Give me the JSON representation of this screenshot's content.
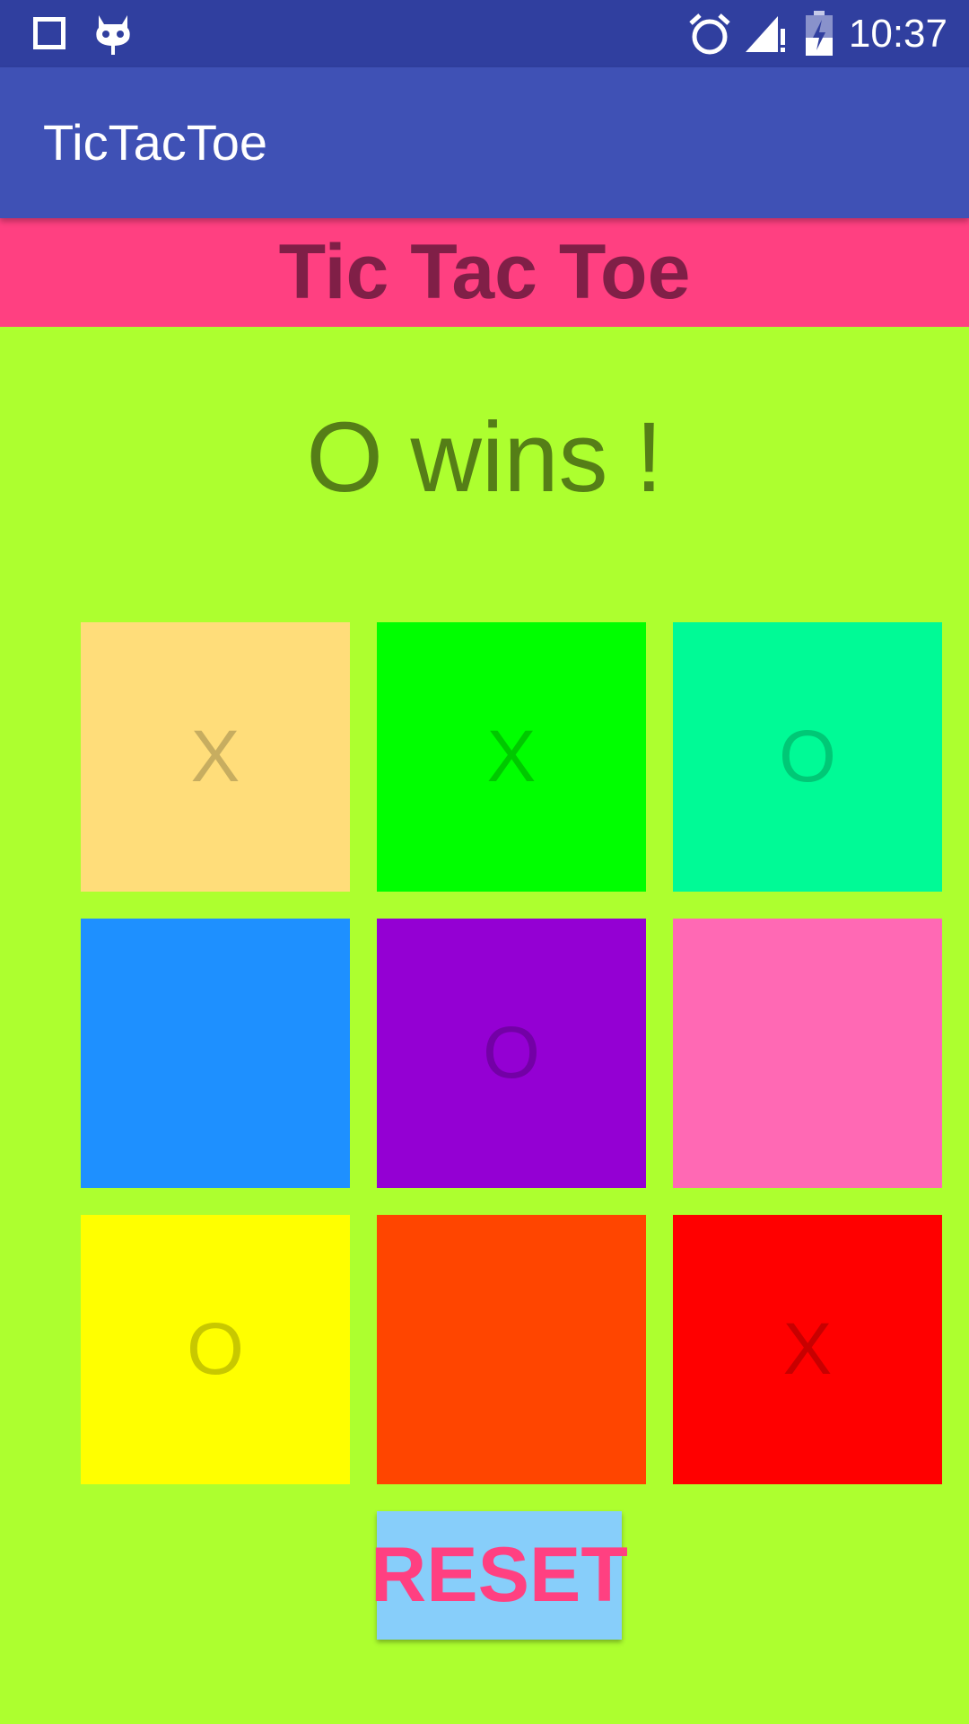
{
  "status_bar": {
    "time": "10:37",
    "icons": [
      "square-notification-icon",
      "cyanogenmod-icon",
      "alarm-icon",
      "signal-icon",
      "battery-charging-icon"
    ]
  },
  "app_bar": {
    "title": "TicTacToe"
  },
  "header": {
    "title": "Tic Tac Toe"
  },
  "game": {
    "status": "O wins !",
    "board": [
      {
        "mark": "X",
        "bg": "#ffdd7a",
        "fg": "#c7ad60"
      },
      {
        "mark": "X",
        "bg": "#00ff00",
        "fg": "#00c800"
      },
      {
        "mark": "O",
        "bg": "#00fa96",
        "fg": "#00c876"
      },
      {
        "mark": "",
        "bg": "#1e90ff",
        "fg": "#1873cc"
      },
      {
        "mark": "O",
        "bg": "#9400d3",
        "fg": "#7300a6"
      },
      {
        "mark": "",
        "bg": "#ff69b4",
        "fg": "#cc5490"
      },
      {
        "mark": "O",
        "bg": "#ffff00",
        "fg": "#c8c800"
      },
      {
        "mark": "",
        "bg": "#ff4500",
        "fg": "#cc3700"
      },
      {
        "mark": "X",
        "bg": "#ff0000",
        "fg": "#c80000"
      }
    ]
  },
  "reset_label": "RESET",
  "colors": {
    "status_bar": "#303f9f",
    "app_bar": "#3f51b5",
    "header_bg": "#ff4081",
    "header_text": "#801f47",
    "background": "#adff2f",
    "status_text": "#557e17",
    "reset_bg": "#87cefa",
    "reset_text": "#ff4081"
  }
}
